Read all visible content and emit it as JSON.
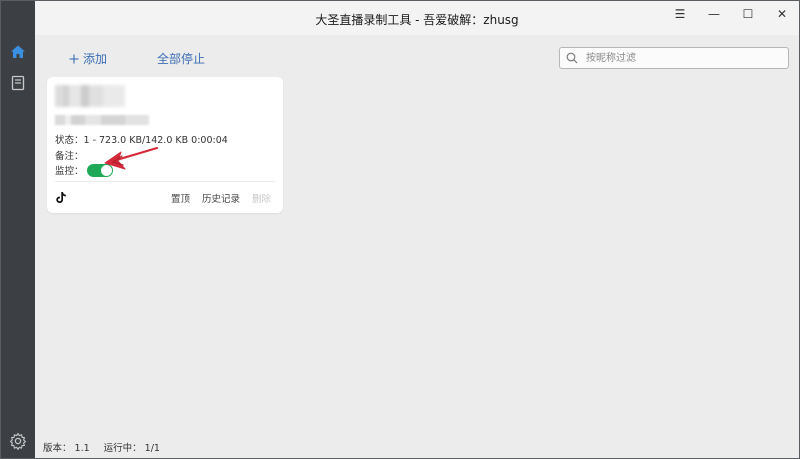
{
  "window": {
    "title": "大圣直播录制工具 - 吾爱破解：zhusg",
    "controls": {
      "menu": "☰",
      "minimize": "—",
      "maximize": "☐",
      "close": "✕"
    }
  },
  "sidebar": {
    "items": [
      {
        "icon": "home-icon"
      },
      {
        "icon": "book-icon"
      },
      {
        "icon": "gear-icon"
      }
    ]
  },
  "toolbar": {
    "add_label": "添加",
    "stop_all_label": "全部停止",
    "search_placeholder": "按昵称过滤"
  },
  "card": {
    "status": "状态：1 - 723.0 KB/142.0 KB 0:00:04",
    "note": "备注：",
    "monitor_label": "监控：",
    "monitor_on": true,
    "platform_icon": "tiktok-icon",
    "actions": {
      "pin": "置顶",
      "history": "历史记录",
      "delete": "删除"
    }
  },
  "footer": {
    "version": "版本： 1.1",
    "running": "运行中： 1/1"
  },
  "colors": {
    "accent": "#3a6db5",
    "toggle_on": "#1fa855",
    "annotation_arrow": "#d62b3b"
  }
}
